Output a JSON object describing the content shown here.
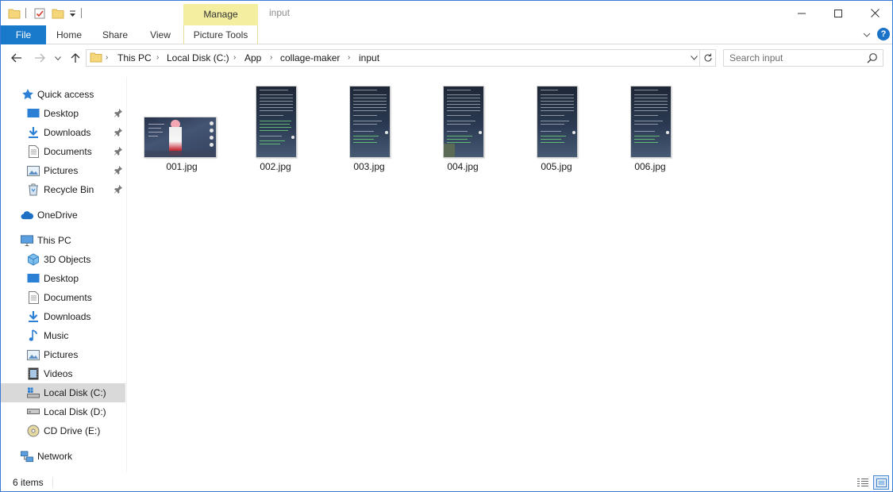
{
  "window": {
    "title": "input",
    "contextual_group_label": "Manage",
    "accent_color": "#1979ca",
    "contextual_color": "#f3eea0"
  },
  "ribbon": {
    "tabs": [
      {
        "label": "File"
      },
      {
        "label": "Home"
      },
      {
        "label": "Share"
      },
      {
        "label": "View"
      },
      {
        "label": "Picture Tools"
      }
    ],
    "help_label": "?"
  },
  "address": {
    "crumbs": [
      "This PC",
      "Local Disk (C:)",
      "App",
      "collage-maker",
      "input"
    ]
  },
  "search": {
    "placeholder": "Search input"
  },
  "nav": {
    "quick_access": {
      "label": "Quick access",
      "items": [
        {
          "label": "Desktop",
          "icon": "desktop-icon",
          "pinned": true
        },
        {
          "label": "Downloads",
          "icon": "downloads-icon",
          "pinned": true
        },
        {
          "label": "Documents",
          "icon": "documents-icon",
          "pinned": true
        },
        {
          "label": "Pictures",
          "icon": "pictures-icon",
          "pinned": true
        },
        {
          "label": "Recycle Bin",
          "icon": "recycle-bin-icon",
          "pinned": true
        }
      ]
    },
    "onedrive": {
      "label": "OneDrive"
    },
    "this_pc": {
      "label": "This PC",
      "items": [
        {
          "label": "3D Objects",
          "icon": "3d-objects-icon"
        },
        {
          "label": "Desktop",
          "icon": "desktop-icon"
        },
        {
          "label": "Documents",
          "icon": "documents-icon"
        },
        {
          "label": "Downloads",
          "icon": "downloads-icon"
        },
        {
          "label": "Music",
          "icon": "music-icon"
        },
        {
          "label": "Pictures",
          "icon": "pictures-icon"
        },
        {
          "label": "Videos",
          "icon": "videos-icon"
        },
        {
          "label": "Local Disk (C:)",
          "icon": "drive-c-icon",
          "selected": true
        },
        {
          "label": "Local Disk (D:)",
          "icon": "drive-icon"
        },
        {
          "label": "CD Drive (E:)",
          "icon": "cd-drive-icon"
        }
      ]
    },
    "network": {
      "label": "Network"
    }
  },
  "files": [
    {
      "name": "001.jpg",
      "orientation": "landscape"
    },
    {
      "name": "002.jpg",
      "orientation": "portrait"
    },
    {
      "name": "003.jpg",
      "orientation": "portrait"
    },
    {
      "name": "004.jpg",
      "orientation": "portrait"
    },
    {
      "name": "005.jpg",
      "orientation": "portrait"
    },
    {
      "name": "006.jpg",
      "orientation": "portrait"
    }
  ],
  "status": {
    "item_count": "6 items"
  }
}
